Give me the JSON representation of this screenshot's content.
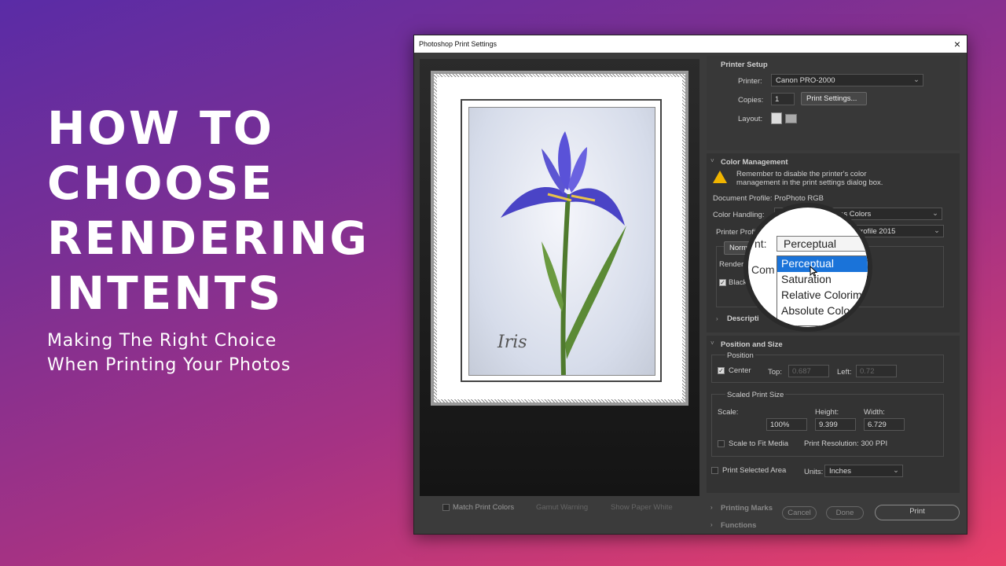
{
  "hero": {
    "title_lines": [
      "HOW TO",
      "CHOOSE",
      "RENDERING",
      "INTENTS"
    ],
    "subtitle_lines": [
      "Making The Right Choice",
      "When Printing Your Photos"
    ]
  },
  "window": {
    "title": "Photoshop Print Settings",
    "close": "×"
  },
  "preview": {
    "caption": "Iris"
  },
  "printer_setup": {
    "heading": "Printer Setup",
    "printer_label": "Printer:",
    "printer_value": "Canon PRO-2000",
    "copies_label": "Copies:",
    "copies_value": "1",
    "print_settings_button": "Print Settings...",
    "layout_label": "Layout:"
  },
  "color_mgmt": {
    "heading": "Color Management",
    "warning_line1": "Remember to disable the printer's color",
    "warning_line2": "management in the print settings dialog box.",
    "document_profile": "Document Profile: ProPhoto RGB",
    "handling_label": "Color Handling:",
    "handling_value": "Photoshop Manages Colors",
    "printer_profile_label": "Printer Profile:",
    "printer_profile_value": "ter Profile 2015",
    "normal_tab": "Normal",
    "rendering_label": "Renderin",
    "black_label": "Black",
    "description_label": "Descripti"
  },
  "magnifier": {
    "intent_partial": "nt:",
    "comp_partial": "Com",
    "selected": "Perceptual",
    "options": [
      "Perceptual",
      "Saturation",
      "Relative Colorim",
      "Absolute Colo"
    ]
  },
  "position_size": {
    "heading": "Position and Size",
    "position_label": "Position",
    "center_label": "Center",
    "top_label": "Top:",
    "top_value": "0.687",
    "left_label": "Left:",
    "left_value": "0.72",
    "scaled_label": "Scaled Print Size",
    "scale_label": "Scale:",
    "height_label": "Height:",
    "width_label": "Width:",
    "scale_value": "100%",
    "height_value": "9.399",
    "width_value": "6.729",
    "fit_media_label": "Scale to Fit Media",
    "resolution": "Print Resolution: 300 PPI",
    "selected_area_label": "Print Selected Area",
    "units_label": "Units:",
    "units_value": "Inches"
  },
  "collapsed": {
    "printing_marks": "Printing Marks",
    "functions": "Functions"
  },
  "footer": {
    "match_colors": "Match Print Colors",
    "gamut_warning": "Gamut Warning",
    "paper_white": "Show Paper White",
    "cancel": "Cancel",
    "done": "Done",
    "print": "Print"
  },
  "colors": {
    "warning": "#f0b400",
    "highlight": "#1a73d9"
  }
}
